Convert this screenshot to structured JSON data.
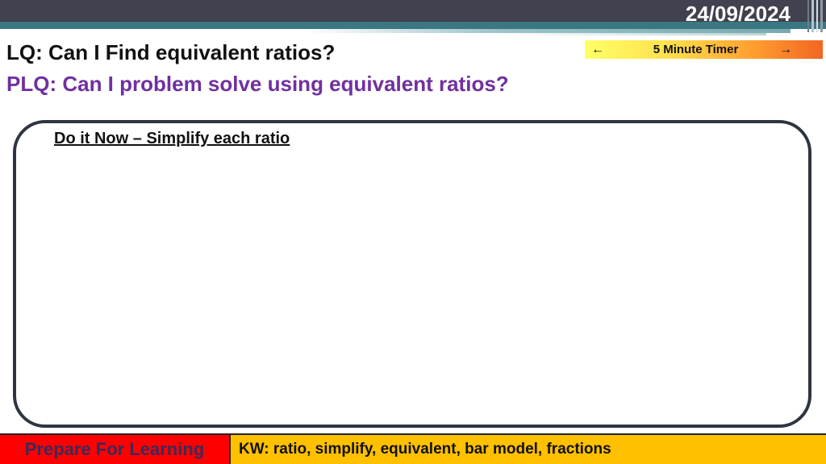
{
  "header": {
    "date": "24/09/2024"
  },
  "titles": {
    "lq": "LQ: Can I Find equivalent ratios?",
    "plq": "PLQ: Can I problem solve using equivalent ratios?"
  },
  "timer": {
    "prev_icon": "←",
    "label": "5 Minute Timer",
    "next_icon": "→"
  },
  "main": {
    "heading": "Do it Now – Simplify each ratio"
  },
  "footer": {
    "prepare": "Prepare For Learning",
    "keywords": "KW: ratio, simplify, equivalent, bar model, fractions"
  },
  "colors": {
    "header_bar": "#41414f",
    "header_strip": "#3a7783",
    "plq_text": "#7030a0",
    "footer_red": "#ff0000",
    "footer_amber": "#ffc000"
  }
}
